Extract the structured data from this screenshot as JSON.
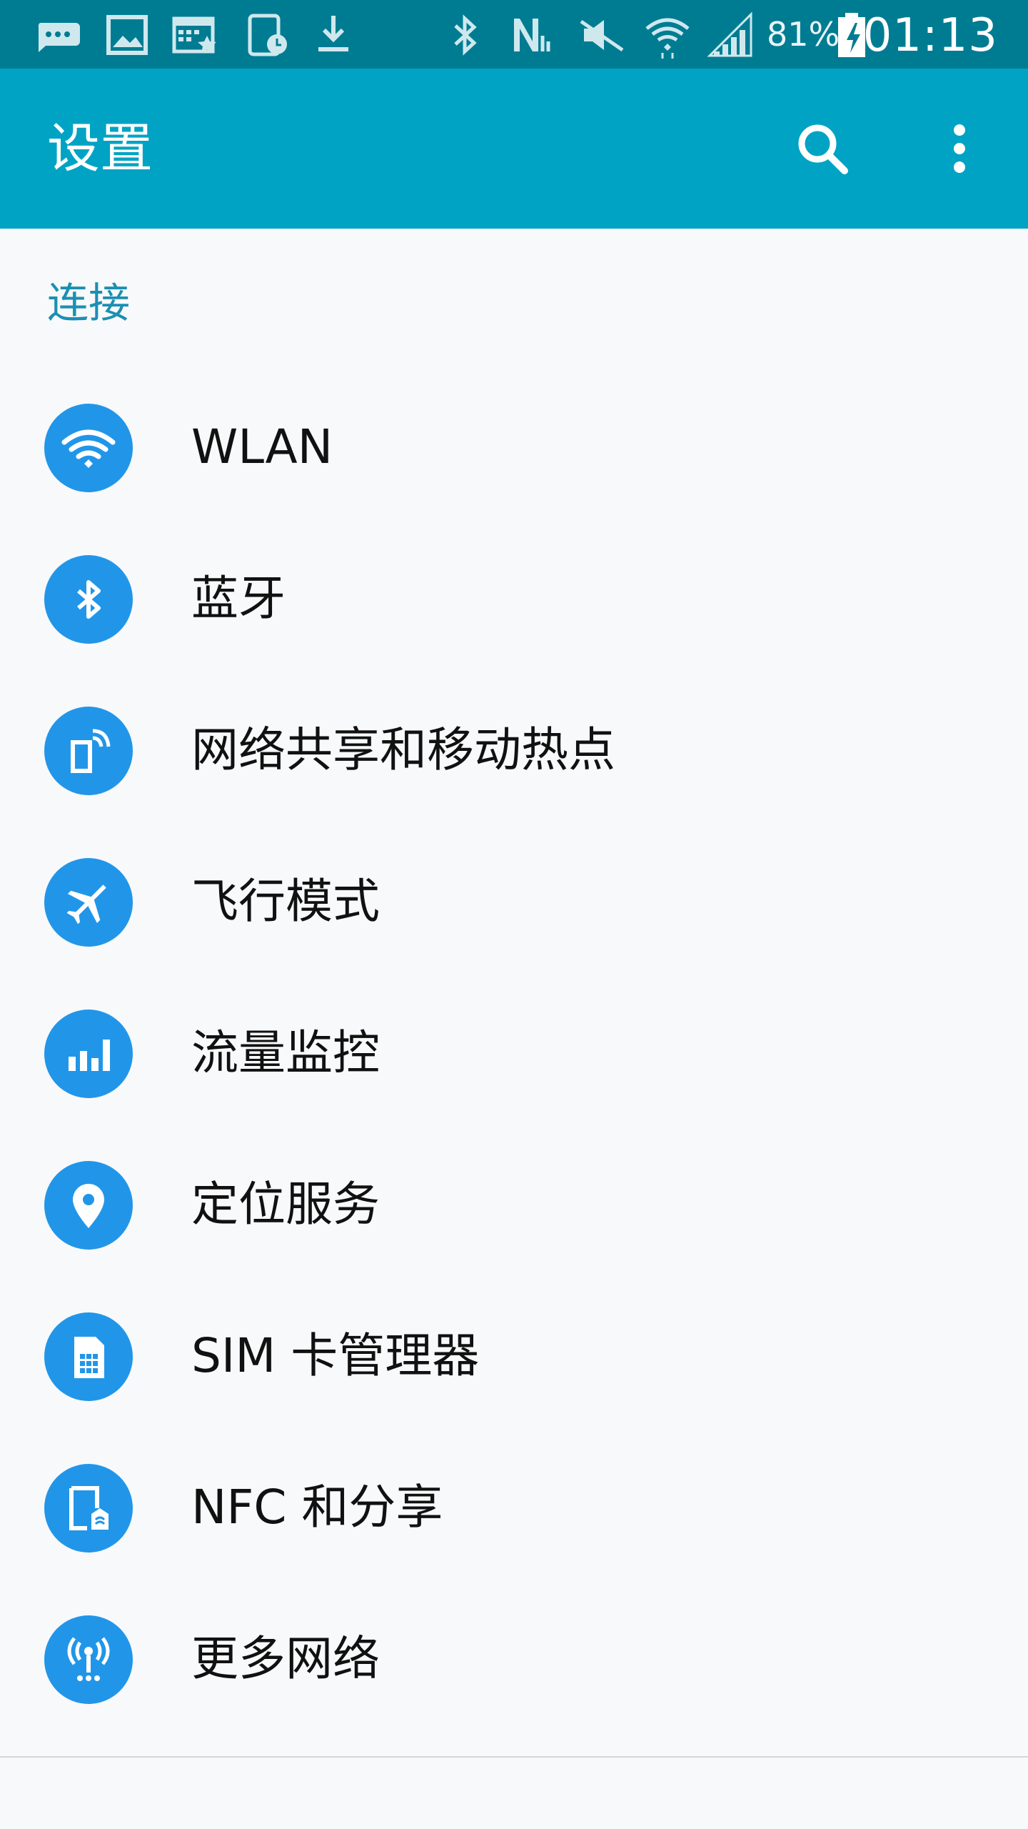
{
  "status_bar": {
    "icons": [
      "message-icon",
      "image-icon",
      "calendar-icon",
      "tablet-clock-icon",
      "download-icon",
      "bluetooth-icon",
      "nfc-icon",
      "mute-icon",
      "wifi-icon",
      "signal-icon",
      "battery-charging-icon"
    ],
    "battery_percent": "81%",
    "time": "01:13"
  },
  "app_bar": {
    "title": "设置",
    "actions": [
      "search-icon",
      "more-vert-icon"
    ]
  },
  "section": {
    "title": "连接"
  },
  "items": [
    {
      "label": "WLAN",
      "icon": "wifi-icon"
    },
    {
      "label": "蓝牙",
      "icon": "bluetooth-icon"
    },
    {
      "label": "网络共享和移动热点",
      "icon": "hotspot-icon"
    },
    {
      "label": "飞行模式",
      "icon": "airplane-icon"
    },
    {
      "label": "流量监控",
      "icon": "data-usage-icon"
    },
    {
      "label": "定位服务",
      "icon": "location-icon"
    },
    {
      "label": "SIM 卡管理器",
      "icon": "sim-card-icon"
    },
    {
      "label": "NFC 和分享",
      "icon": "nfc-share-icon"
    },
    {
      "label": "更多网络",
      "icon": "more-networks-icon"
    }
  ],
  "colors": {
    "status_bar": "#007c92",
    "app_bar": "#00a3c4",
    "accent": "#1b8fb3",
    "icon_circle": "#2196e9",
    "background": "#f8f9fa"
  }
}
